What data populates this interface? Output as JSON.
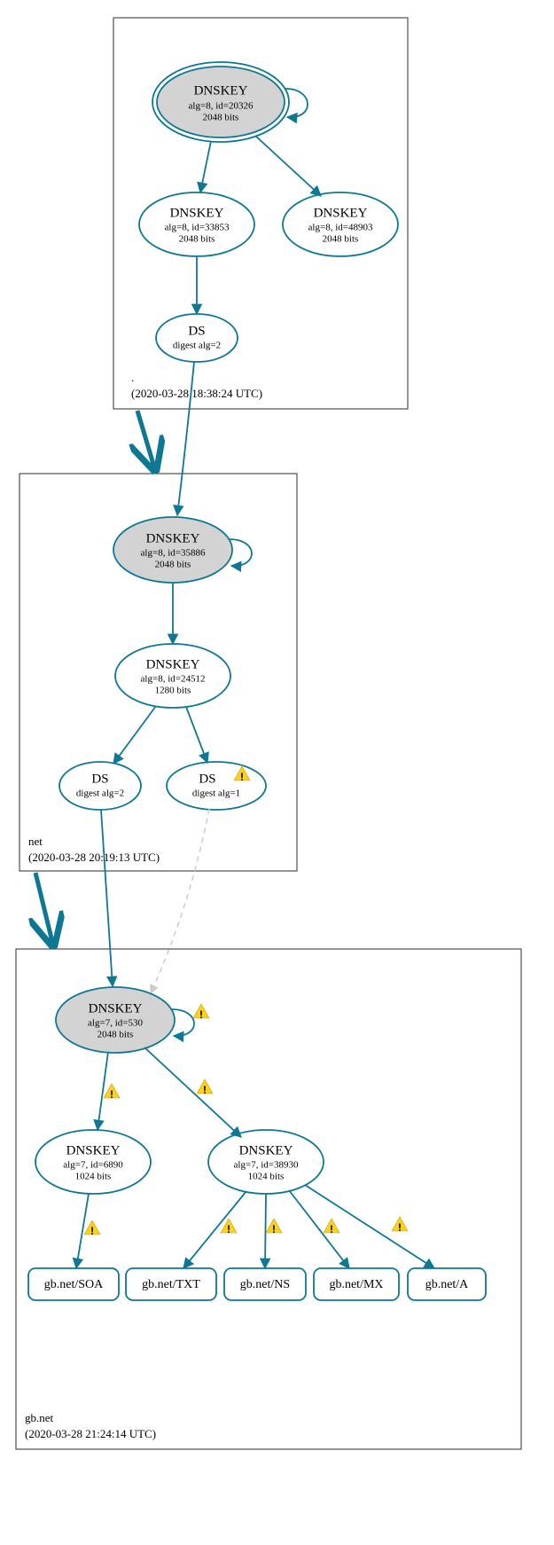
{
  "colors": {
    "stroke": "#0e7894",
    "ksk_fill": "#d3d3d3",
    "warn_fill": "#fbd11a",
    "warn_stroke": "#d19a00"
  },
  "zones": {
    "root": {
      "name": ".",
      "timestamp": "(2020-03-28 18:38:24 UTC)"
    },
    "net": {
      "name": "net",
      "timestamp": "(2020-03-28 20:19:13 UTC)"
    },
    "gb": {
      "name": "gb.net",
      "timestamp": "(2020-03-28 21:24:14 UTC)"
    }
  },
  "nodes": {
    "root_ksk": {
      "title": "DNSKEY",
      "line1": "alg=8, id=20326",
      "line2": "2048 bits"
    },
    "root_zsk1": {
      "title": "DNSKEY",
      "line1": "alg=8, id=33853",
      "line2": "2048 bits"
    },
    "root_zsk2": {
      "title": "DNSKEY",
      "line1": "alg=8, id=48903",
      "line2": "2048 bits"
    },
    "root_ds": {
      "title": "DS",
      "line1": "digest alg=2"
    },
    "net_ksk": {
      "title": "DNSKEY",
      "line1": "alg=8, id=35886",
      "line2": "2048 bits"
    },
    "net_zsk": {
      "title": "DNSKEY",
      "line1": "alg=8, id=24512",
      "line2": "1280 bits"
    },
    "net_ds1": {
      "title": "DS",
      "line1": "digest alg=2"
    },
    "net_ds2": {
      "title": "DS",
      "line1": "digest alg=1"
    },
    "gb_ksk": {
      "title": "DNSKEY",
      "line1": "alg=7, id=530",
      "line2": "2048 bits"
    },
    "gb_zsk1": {
      "title": "DNSKEY",
      "line1": "alg=7, id=6890",
      "line2": "1024 bits"
    },
    "gb_zsk2": {
      "title": "DNSKEY",
      "line1": "alg=7, id=38930",
      "line2": "1024 bits"
    }
  },
  "rrsets": {
    "soa": "gb.net/SOA",
    "txt": "gb.net/TXT",
    "ns": "gb.net/NS",
    "mx": "gb.net/MX",
    "a": "gb.net/A"
  }
}
